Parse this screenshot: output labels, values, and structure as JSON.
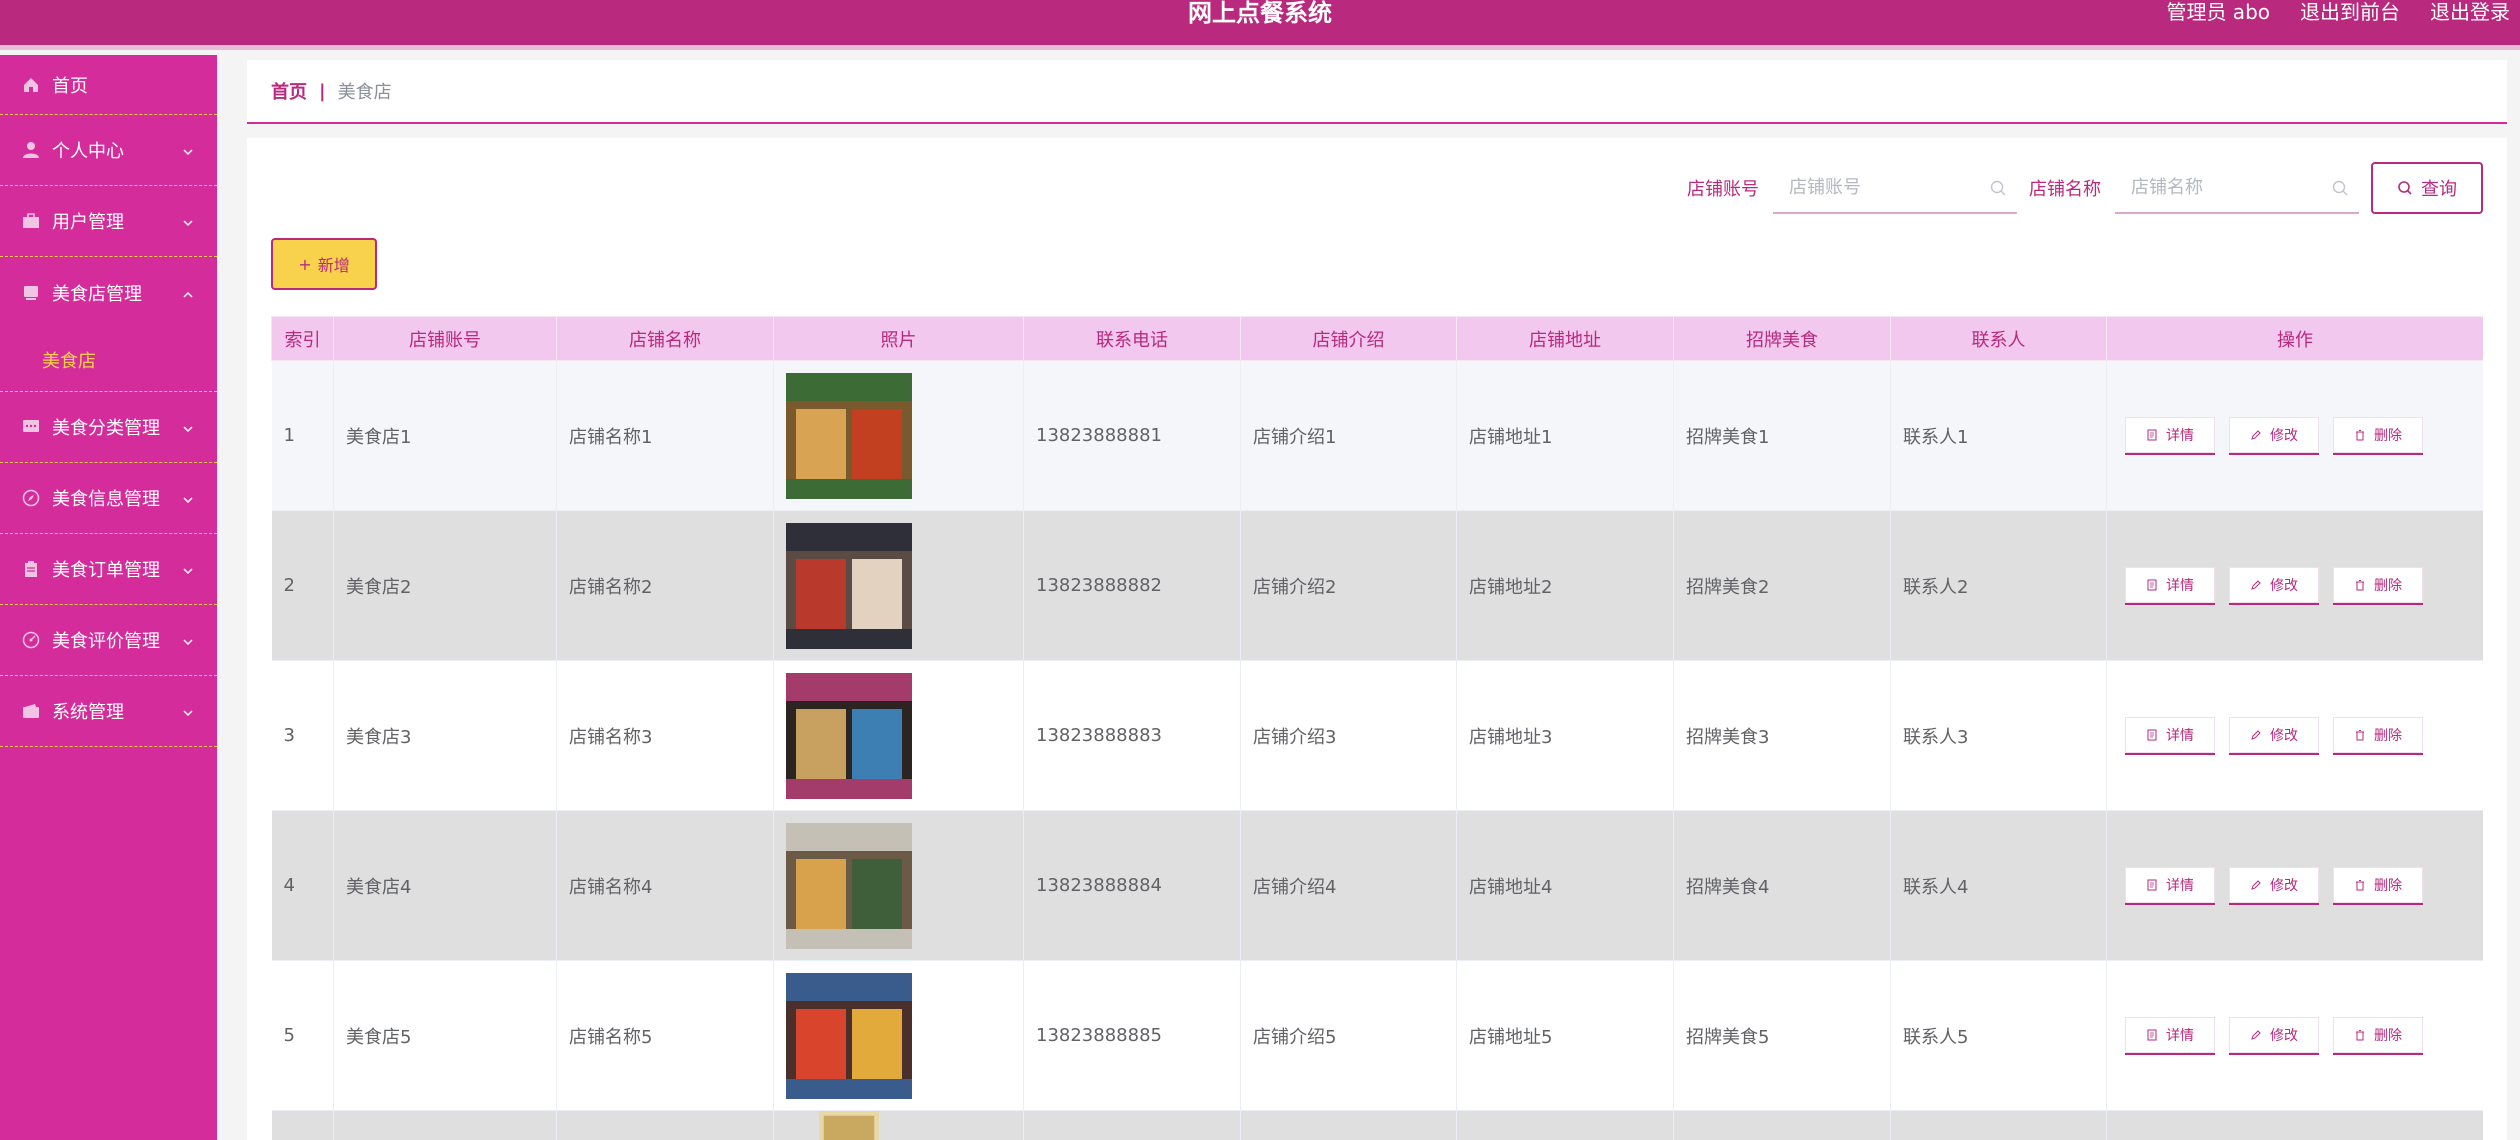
{
  "header": {
    "title": "网上点餐系统",
    "admin_label": "管理员 abo",
    "back_to_front": "退出到前台",
    "logout": "退出登录"
  },
  "sidebar": {
    "items": [
      {
        "label": "首页",
        "icon": "home-icon"
      },
      {
        "label": "个人中心",
        "icon": "user-icon"
      },
      {
        "label": "用户管理",
        "icon": "briefcase-icon"
      },
      {
        "label": "美食店管理",
        "icon": "store-icon"
      },
      {
        "label": "美食分类管理",
        "icon": "chat-icon"
      },
      {
        "label": "美食信息管理",
        "icon": "compass-icon"
      },
      {
        "label": "美食订单管理",
        "icon": "clipboard-icon"
      },
      {
        "label": "美食评价管理",
        "icon": "gauge-icon"
      },
      {
        "label": "系统管理",
        "icon": "wallet-icon"
      }
    ],
    "active_sub": "美食店"
  },
  "breadcrumb": {
    "home": "首页",
    "separator": "|",
    "current": "美食店"
  },
  "search": {
    "account_label": "店铺账号",
    "account_placeholder": "店铺账号",
    "name_label": "店铺名称",
    "name_placeholder": "店铺名称",
    "query_button": "查询"
  },
  "add_button": "新增",
  "table": {
    "columns": [
      "索引",
      "店铺账号",
      "店铺名称",
      "照片",
      "联系电话",
      "店铺介绍",
      "店铺地址",
      "招牌美食",
      "联系人",
      "操作"
    ],
    "rows": [
      {
        "index": "1",
        "account": "美食店1",
        "name": "店铺名称1",
        "phone": "13823888881",
        "intro": "店铺介绍1",
        "address": "店铺地址1",
        "food": "招牌美食1",
        "contact": "联系人1"
      },
      {
        "index": "2",
        "account": "美食店2",
        "name": "店铺名称2",
        "phone": "13823888882",
        "intro": "店铺介绍2",
        "address": "店铺地址2",
        "food": "招牌美食2",
        "contact": "联系人2"
      },
      {
        "index": "3",
        "account": "美食店3",
        "name": "店铺名称3",
        "phone": "13823888883",
        "intro": "店铺介绍3",
        "address": "店铺地址3",
        "food": "招牌美食3",
        "contact": "联系人3"
      },
      {
        "index": "4",
        "account": "美食店4",
        "name": "店铺名称4",
        "phone": "13823888884",
        "intro": "店铺介绍4",
        "address": "店铺地址4",
        "food": "招牌美食4",
        "contact": "联系人4"
      },
      {
        "index": "5",
        "account": "美食店5",
        "name": "店铺名称5",
        "phone": "13823888885",
        "intro": "店铺介绍5",
        "address": "店铺地址5",
        "food": "招牌美食5",
        "contact": "联系人5"
      }
    ],
    "ops": {
      "detail": "详情",
      "edit": "修改",
      "delete": "删除"
    }
  },
  "colors": {
    "header_bg": "#b92a7e",
    "sidebar_bg": "#d42d9b",
    "accent": "#b92a7e",
    "add_button_bg": "#f7d24a",
    "table_header_bg": "#f2c8ee"
  }
}
